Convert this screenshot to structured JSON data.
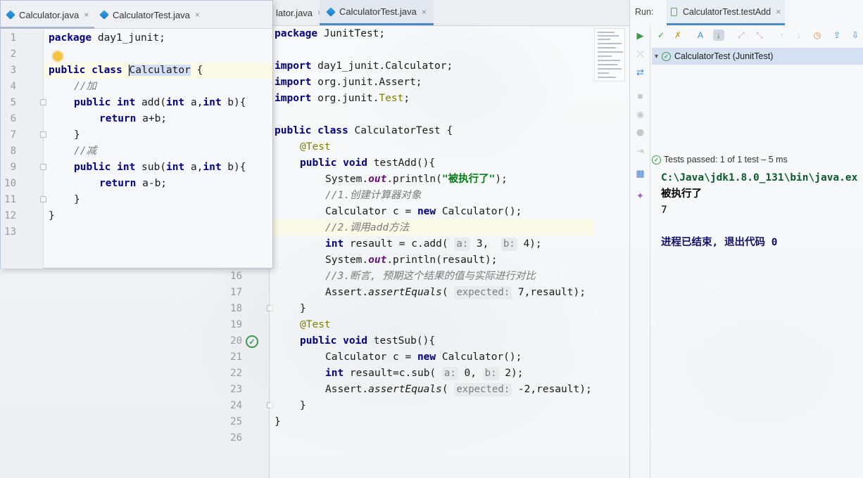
{
  "main_editor": {
    "tabs": [
      {
        "label": "lator.java",
        "icon": "java-class-icon"
      },
      {
        "label": "CalculatorTest.java",
        "icon": "java-class-icon"
      }
    ],
    "lines": [
      {
        "n": "16"
      },
      {
        "n": "17"
      },
      {
        "n": "18"
      },
      {
        "n": "19"
      },
      {
        "n": "20"
      },
      {
        "n": "21"
      },
      {
        "n": "22"
      },
      {
        "n": "23"
      },
      {
        "n": "24"
      },
      {
        "n": "25"
      },
      {
        "n": "26"
      }
    ],
    "code": {
      "l1_kw": "package",
      "l1_rest": " JunitTest;",
      "l3_kw": "import",
      "l3_rest": " day1_junit.Calculator;",
      "l4_kw": "import",
      "l4_rest": " org.junit.Assert;",
      "l5_kw": "import",
      "l5_rest_a": " org.junit.",
      "l5_rest_b": "Test",
      "l5_rest_c": ";",
      "l7_kw": "public class",
      "l7_rest": " CalculatorTest {",
      "l8_ann": "@Test",
      "l9_kw": "public void",
      "l9_rest": " testAdd(){",
      "l10_a": "System.",
      "l10_fld": "out",
      "l10_b": ".println(",
      "l10_str": "\"被执行了\"",
      "l10_c": ");",
      "l11_cmt": "//1.创建计算器对象",
      "l12_a": "Calculator c = ",
      "l12_kw": "new",
      "l12_b": " Calculator();",
      "l13_cmt": "//2.调用add方法",
      "l14_kw": "int",
      "l14_a": " resault = c.add( ",
      "l14_h1": "a:",
      "l14_v1": " 3,  ",
      "l14_h2": "b:",
      "l14_v2": " 4);",
      "l15_a": "System.",
      "l15_fld": "out",
      "l15_b": ".println(resault);",
      "l16_cmt": "//3.断言, 预期这个结果的值与实际进行对比",
      "l17_a": "Assert.",
      "l17_m": "assertEquals",
      "l17_b": "( ",
      "l17_h": "expected:",
      "l17_c": " 7,resault);",
      "l18": "}",
      "l19_ann": "@Test",
      "l20_kw": "public void",
      "l20_rest": " testSub(){",
      "l21_a": "Calculator c = ",
      "l21_kw": "new",
      "l21_b": " Calculator();",
      "l22_kw": "int",
      "l22_a": " resault=c.sub( ",
      "l22_h1": "a:",
      "l22_v1": " 0, ",
      "l22_h2": "b:",
      "l22_v2": " 2);",
      "l23_a": "Assert.",
      "l23_m": "assertEquals",
      "l23_b": "( ",
      "l23_h": "expected:",
      "l23_c": " -2,resault);",
      "l24": "}",
      "l25": "}"
    },
    "run_check_glyph": "✓"
  },
  "float_editor": {
    "tabs": [
      {
        "label": "Calculator.java",
        "icon": "java-class-icon"
      },
      {
        "label": "CalculatorTest.java",
        "icon": "java-class-icon"
      }
    ],
    "lines": [
      "1",
      "2",
      "3",
      "4",
      "5",
      "6",
      "7",
      "8",
      "9",
      "10",
      "11",
      "12",
      "13"
    ],
    "code": {
      "l1_kw": "package",
      "l1_rest": " day1_junit;",
      "l3_kw": "public class",
      "l3_sp": " ",
      "l3_word": "Calculator",
      "l3_rest": " {",
      "l4_cmt": "//加",
      "l5_kw1": "public int",
      "l5_a": " add(",
      "l5_kw2": "int",
      "l5_b": " a,",
      "l5_kw3": "int",
      "l5_c": " b){",
      "l6_kw": "return",
      "l6_rest": " a+b;",
      "l7": "}",
      "l8_cmt": "//减",
      "l9_kw1": "public int",
      "l9_a": " sub(",
      "l9_kw2": "int",
      "l9_b": " a,",
      "l9_kw3": "int",
      "l9_c": " b){",
      "l10_kw": "return",
      "l10_rest": " a-b;",
      "l11": "}",
      "l12": "}"
    }
  },
  "run_panel": {
    "label": "Run:",
    "tab": {
      "label": "CalculatorTest.testAdd",
      "close": "×"
    },
    "tree_item": "CalculatorTest (JunitTest)",
    "status": "Tests passed: 1 of 1 test – 5 ms",
    "console": {
      "path": "C:\\Java\\jdk1.8.0_131\\bin\\java.ex",
      "out1": "被执行了",
      "out2": "7",
      "exit": "进程已结束, 退出代码 0"
    }
  },
  "colors": {
    "accent": "#4a88c7",
    "pass_green": "#3d9a4a",
    "keyword": "#000080",
    "string": "#067d17",
    "annotation": "#808000"
  },
  "close_glyph": "×"
}
